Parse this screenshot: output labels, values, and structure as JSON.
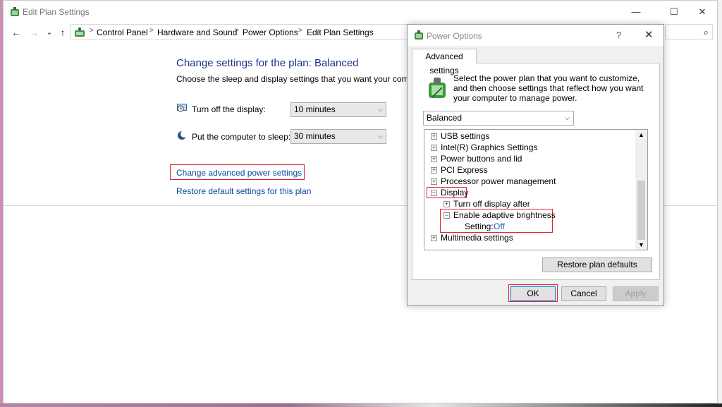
{
  "window": {
    "title": "Edit Plan Settings",
    "controls": {
      "minimize": "—",
      "maximize": "☐",
      "close": "✕"
    }
  },
  "nav": {
    "back": "←",
    "forward": "→",
    "recent": "⌄",
    "up": "↑",
    "sep": ">",
    "search_icon": "⌕"
  },
  "breadcrumb": [
    "Control Panel",
    "Hardware and Sound",
    "Power Options",
    "Edit Plan Settings"
  ],
  "main": {
    "title": "Change settings for the plan: Balanced",
    "subtitle": "Choose the sleep and display settings that you want your computer to use.",
    "settings": [
      {
        "label": "Turn off the display:",
        "value": "10 minutes",
        "icon": "monitor-clock-icon"
      },
      {
        "label": "Put the computer to sleep:",
        "value": "30 minutes",
        "icon": "moon-icon"
      }
    ],
    "links": {
      "advanced": "Change advanced power settings",
      "restore": "Restore default settings for this plan"
    }
  },
  "dialog": {
    "title": "Power Options",
    "help": "?",
    "close": "✕",
    "tab": "Advanced settings",
    "description": "Select the power plan that you want to customize, and then choose settings that reflect how you want your computer to manage power.",
    "plan_select": "Balanced",
    "tree": [
      {
        "label": "USB settings",
        "expander": "+",
        "indent": 0
      },
      {
        "label": "Intel(R) Graphics Settings",
        "expander": "+",
        "indent": 0
      },
      {
        "label": "Power buttons and lid",
        "expander": "+",
        "indent": 0
      },
      {
        "label": "PCI Express",
        "expander": "+",
        "indent": 0
      },
      {
        "label": "Processor power management",
        "expander": "+",
        "indent": 0
      },
      {
        "label": "Display",
        "expander": "−",
        "indent": 0
      },
      {
        "label": "Turn off display after",
        "expander": "+",
        "indent": 1
      },
      {
        "label": "Enable adaptive brightness",
        "expander": "−",
        "indent": 1
      },
      {
        "label": "Setting:",
        "value": "Off",
        "indent": 2
      },
      {
        "label": "Multimedia settings",
        "expander": "+",
        "indent": 0
      }
    ],
    "scroll": {
      "up": "▲",
      "down": "▼"
    },
    "restore_btn": "Restore plan defaults",
    "ok_btn": "OK",
    "cancel_btn": "Cancel",
    "apply_btn": "Apply"
  },
  "colors": {
    "link": "#0b47a1",
    "title": "#1e3287",
    "highlight": "#e0242c"
  }
}
